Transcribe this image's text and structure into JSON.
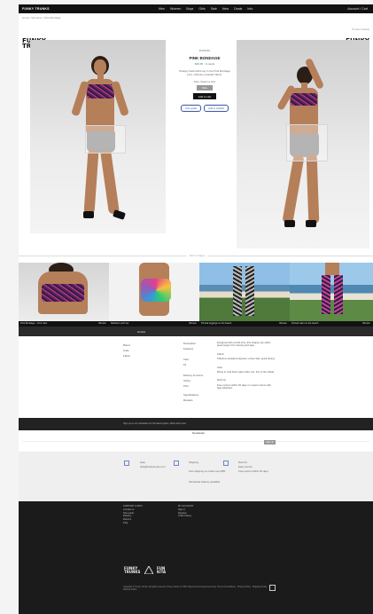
{
  "nav": {
    "brand": "FUNKY TRUNKS",
    "links": [
      "Men",
      "Women",
      "Boys",
      "Girls",
      "Sale",
      "New",
      "Deals",
      "Info"
    ],
    "right": "Account / Cart"
  },
  "breadcrumb": "Home / Womens / Pink Bondage",
  "page_top_right": "Product details",
  "logos": {
    "left": "FUNKY\nTRUNKS",
    "right": "FUNKY\nTRUNKS"
  },
  "product": {
    "brand": "FUNKITA",
    "title": "PINK BONDAGE",
    "price": "$39.95 · In stock",
    "description": "Strappy back bikini top in the Pink Bondage print. Chlorine resistant fabric.",
    "size_label": "Size: Select a size",
    "size_button": "Size",
    "add_button": "Add to cart",
    "link_one": "Size guide",
    "link_two": "Add to wishlist"
  },
  "divider_text": "More images",
  "gallery": [
    {
      "caption": "Pink Bondage – front view",
      "tag": "Women"
    },
    {
      "caption": "Rainbow print top",
      "tag": "Women"
    },
    {
      "caption": "Printed leggings on the beach",
      "tag": "Women"
    },
    {
      "caption": "Printed capri on the beach",
      "tag": "Women"
    }
  ],
  "band_text": "Details",
  "details": {
    "col1": [
      "Brand",
      "Code",
      "Fabric"
    ],
    "col2": [
      "Description",
      "Features",
      "Care",
      "Fit",
      "Delivery & returns",
      "Sizing",
      "Print",
      "Specifications",
      "Reviews"
    ],
    "col3": [
      "Designed with a bold print, this strappy top offers great support for training and laps.",
      "Fabric",
      "Chlorine resistant polyester, colour fast, quick drying.",
      "Care",
      "Rinse in cold fresh water after use. Dry in the shade.",
      "Returns",
      "Free returns within 30 days on unworn items with tags attached."
    ]
  },
  "dark_strip": "Sign up to our newsletter for the latest styles, offers and news",
  "newsletter": {
    "title": "Newsletter",
    "button": "Sign up"
  },
  "contact": {
    "c1_title": "Help",
    "c1_text": "help@funkytrunks.com",
    "c2_title": "Shipping",
    "c2_text": "Free shipping on orders over $50",
    "c2_sub": "Worldwide delivery available",
    "c3_title": "Returns",
    "c3_text": "Easy returns",
    "c3_sub": "Free returns within 30 days"
  },
  "footer": {
    "col1_title": "SUPPORT & INFO",
    "col1": [
      "Contact us",
      "Size guide",
      "Delivery",
      "Returns",
      "FAQ"
    ],
    "col2_title": "MY ACCOUNT",
    "col2": [
      "Sign in",
      "Register",
      "Order history"
    ],
    "logo_text": "FUNKY TRUNKS",
    "legal": "Copyright © Funky Trunks. All rights reserved. Prices shown in USD. Payments processed securely. Terms & Conditions · Privacy Policy · Shipping Policy · Returns Policy."
  }
}
